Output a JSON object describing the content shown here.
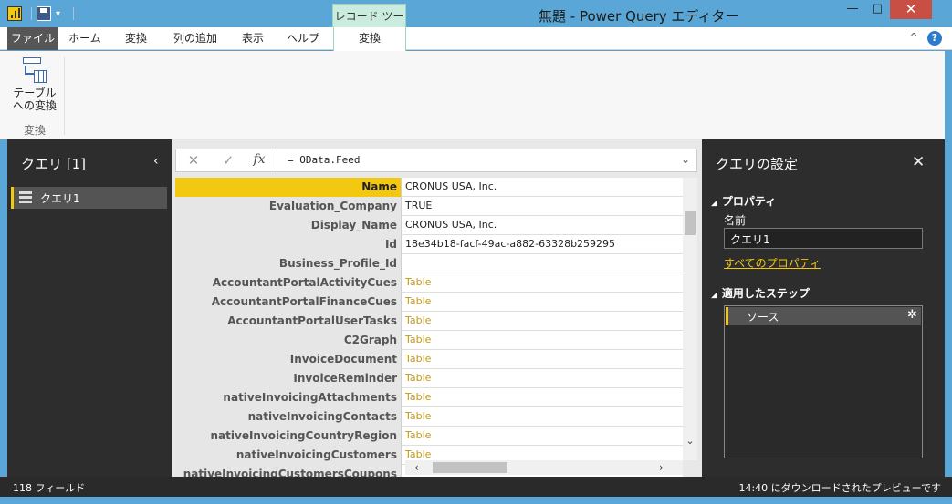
{
  "window": {
    "title": "無題 - Power Query エディター",
    "contextual_tab_header": "レコード ツール",
    "minimize": "—",
    "maximize": "□",
    "close": "✕",
    "quick_access_dropdown": "▾"
  },
  "ribbon": {
    "tabs": [
      "ファイル",
      "ホーム",
      "変換",
      "列の追加",
      "表示",
      "ヘルプ",
      "変換"
    ],
    "active_tab": "変換",
    "collapse_icon": "^",
    "help_icon": "?",
    "button": {
      "line1": "テーブル",
      "line2": "への変換"
    },
    "group_label": "変換"
  },
  "queries": {
    "title": "クエリ [1]",
    "collapse_icon": "‹",
    "items": [
      {
        "label": "クエリ1"
      }
    ]
  },
  "formula": {
    "cancel": "✕",
    "confirm": "✓",
    "fx": "fx",
    "text": "= OData.Feed",
    "expand": "⌄"
  },
  "record": {
    "rows": [
      {
        "key": "Name",
        "value": "CRONUS USA, Inc.",
        "link": false
      },
      {
        "key": "Evaluation_Company",
        "value": "TRUE",
        "link": false
      },
      {
        "key": "Display_Name",
        "value": "CRONUS USA, Inc.",
        "link": false
      },
      {
        "key": "Id",
        "value": "18e34b18-facf-49ac-a882-63328b259295",
        "link": false
      },
      {
        "key": "Business_Profile_Id",
        "value": "",
        "link": false
      },
      {
        "key": "AccountantPortalActivityCues",
        "value": "Table",
        "link": true
      },
      {
        "key": "AccountantPortalFinanceCues",
        "value": "Table",
        "link": true
      },
      {
        "key": "AccountantPortalUserTasks",
        "value": "Table",
        "link": true
      },
      {
        "key": "C2Graph",
        "value": "Table",
        "link": true
      },
      {
        "key": "InvoiceDocument",
        "value": "Table",
        "link": true
      },
      {
        "key": "InvoiceReminder",
        "value": "Table",
        "link": true
      },
      {
        "key": "nativeInvoicingAttachments",
        "value": "Table",
        "link": true
      },
      {
        "key": "nativeInvoicingContacts",
        "value": "Table",
        "link": true
      },
      {
        "key": "nativeInvoicingCountryRegion",
        "value": "Table",
        "link": true
      },
      {
        "key": "nativeInvoicingCustomers",
        "value": "Table",
        "link": true
      },
      {
        "key": "nativeInvoicingCustomersCoupons",
        "value": "",
        "link": false
      }
    ],
    "selected_index": 0
  },
  "scroll": {
    "down": "⌄",
    "left": "‹",
    "right": "›"
  },
  "settings": {
    "title": "クエリの設定",
    "close": "✕",
    "properties_header": "プロパティ",
    "name_label": "名前",
    "name_value": "クエリ1",
    "all_properties_link": "すべてのプロパティ",
    "steps_header": "適用したステップ",
    "steps": [
      {
        "label": "ソース"
      }
    ],
    "gear_icon": "✲",
    "triangle": "◢"
  },
  "status": {
    "left": "118 フィールド",
    "right": "14:40 にダウンロードされたプレビューです"
  }
}
